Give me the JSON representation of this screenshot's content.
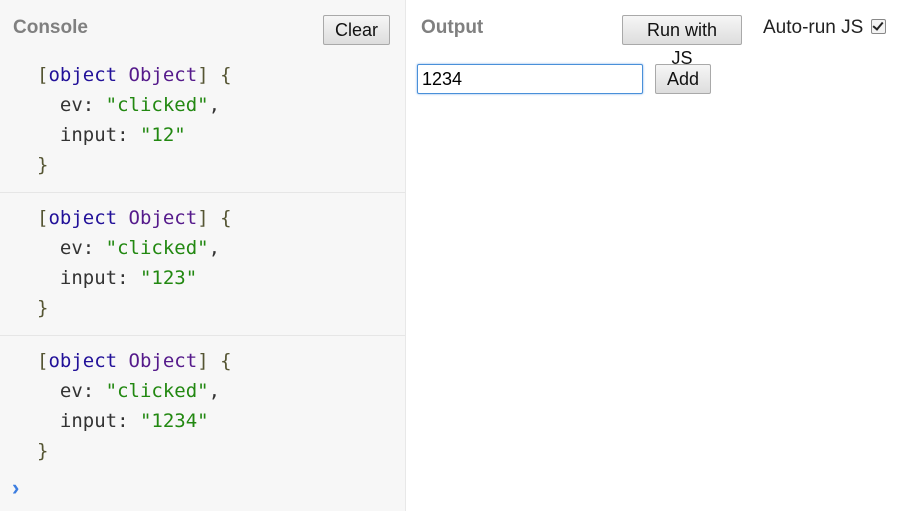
{
  "console": {
    "title": "Console",
    "clear_label": "Clear",
    "prompt_glyph": "›",
    "entries": [
      {
        "head_open": "[",
        "type_word": "object",
        "class_word": "Object",
        "head_close": "]",
        "brace_open": "{",
        "ev_key": "ev",
        "ev_value": "\"clicked\"",
        "input_key": "input",
        "input_value": "\"12\"",
        "brace_close": "}"
      },
      {
        "head_open": "[",
        "type_word": "object",
        "class_word": "Object",
        "head_close": "]",
        "brace_open": "{",
        "ev_key": "ev",
        "ev_value": "\"clicked\"",
        "input_key": "input",
        "input_value": "\"123\"",
        "brace_close": "}"
      },
      {
        "head_open": "[",
        "type_word": "object",
        "class_word": "Object",
        "head_close": "]",
        "brace_open": "{",
        "ev_key": "ev",
        "ev_value": "\"clicked\"",
        "input_key": "input",
        "input_value": "\"1234\"",
        "brace_close": "}"
      }
    ]
  },
  "output": {
    "title": "Output",
    "run_label": "Run with JS",
    "autorun_label": "Auto-run JS",
    "autorun_checked": true,
    "input_value": "1234",
    "add_label": "Add"
  },
  "colors": {
    "string": "#228811",
    "type": "#221199",
    "class": "#551a8b",
    "prompt": "#3d7ee0"
  }
}
